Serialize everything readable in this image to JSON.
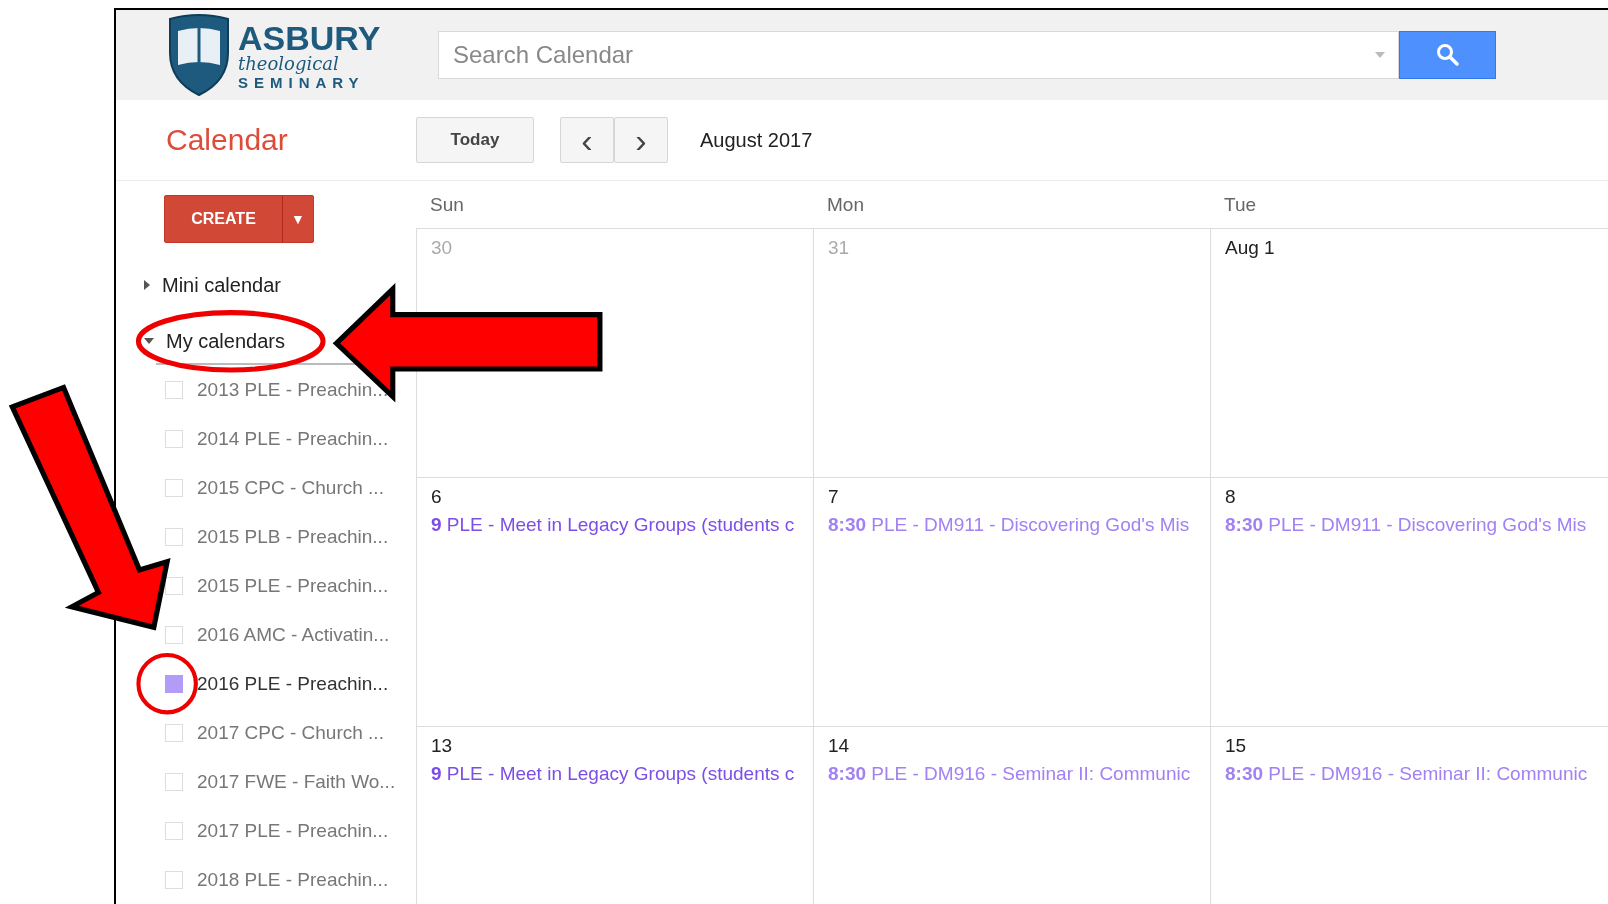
{
  "logo": {
    "name": "ASBURY",
    "tagline": "theological",
    "subtitle": "SEMINARY"
  },
  "search": {
    "placeholder": "Search Calendar"
  },
  "app_title": "Calendar",
  "toolbar": {
    "today": "Today",
    "prev": "‹",
    "next": "›",
    "period": "August 2017"
  },
  "create": {
    "label": "CREATE",
    "caret": "▼"
  },
  "sections": [
    {
      "label": "Mini calendar",
      "expanded": false
    },
    {
      "label": "My calendars",
      "expanded": true
    }
  ],
  "calendars": [
    {
      "label": "2013 PLE - Preachin...",
      "checked": false
    },
    {
      "label": "2014 PLE - Preachin...",
      "checked": false
    },
    {
      "label": "2015 CPC - Church ...",
      "checked": false
    },
    {
      "label": "2015 PLB - Preachin...",
      "checked": false
    },
    {
      "label": "2015 PLE - Preachin...",
      "checked": false
    },
    {
      "label": "2016 AMC - Activatin...",
      "checked": false
    },
    {
      "label": "2016 PLE - Preachin...",
      "checked": true
    },
    {
      "label": "2017 CPC - Church ...",
      "checked": false
    },
    {
      "label": "2017 FWE - Faith Wo...",
      "checked": false
    },
    {
      "label": "2017 PLE - Preachin...",
      "checked": false
    },
    {
      "label": "2018 PLE - Preachin...",
      "checked": false
    }
  ],
  "weekdays": [
    "Sun",
    "Mon",
    "Tue"
  ],
  "weeks": [
    [
      {
        "day": "30",
        "other_month": true
      },
      {
        "day": "31",
        "other_month": true
      },
      {
        "day": "Aug 1",
        "other_month": false
      }
    ],
    [
      {
        "day": "6",
        "other_month": false,
        "events": [
          {
            "text": "**9** PLE - Meet in Legacy Groups (students c",
            "color": "#7c4ee8"
          }
        ]
      },
      {
        "day": "7",
        "other_month": false,
        "events": [
          {
            "text": "**8:30** PLE - DM911 - Discovering God's Mis",
            "color": "#a281f2"
          }
        ]
      },
      {
        "day": "8",
        "other_month": false,
        "events": [
          {
            "text": "**8:30** PLE - DM911 - Discovering God's Mis",
            "color": "#a281f2"
          }
        ]
      }
    ],
    [
      {
        "day": "13",
        "other_month": false,
        "events": [
          {
            "text": "**9** PLE - Meet in Legacy Groups (students c",
            "color": "#7c4ee8"
          }
        ]
      },
      {
        "day": "14",
        "other_month": false,
        "events": [
          {
            "text": "**8:30** PLE - DM916 - Seminar II: Communic",
            "color": "#a281f2"
          }
        ]
      },
      {
        "day": "15",
        "other_month": false,
        "events": [
          {
            "text": "**8:30** PLE - DM916 - Seminar II: Communic",
            "color": "#a281f2"
          }
        ]
      }
    ]
  ]
}
